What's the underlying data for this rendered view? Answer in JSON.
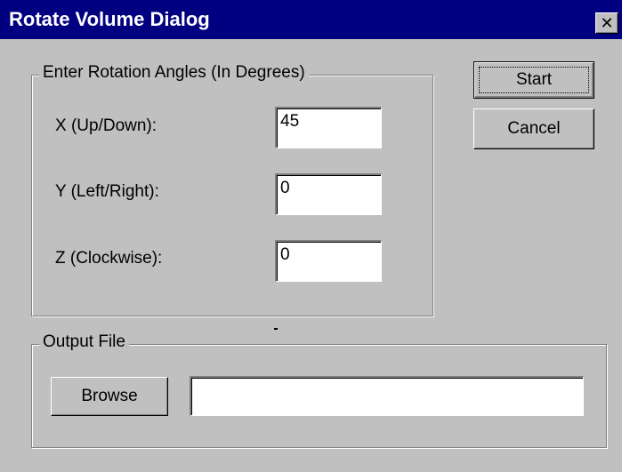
{
  "window": {
    "title": "Rotate Volume Dialog",
    "close_glyph": "✕"
  },
  "rotation_group": {
    "label": "Enter Rotation Angles (In Degrees)",
    "fields": [
      {
        "label": "X (Up/Down):",
        "value": "45"
      },
      {
        "label": "Y (Left/Right):",
        "value": "0"
      },
      {
        "label": "Z (Clockwise):",
        "value": "0"
      }
    ]
  },
  "buttons": {
    "start": "Start",
    "cancel": "Cancel",
    "browse": "Browse"
  },
  "output_group": {
    "label": "Output File",
    "path_value": ""
  }
}
